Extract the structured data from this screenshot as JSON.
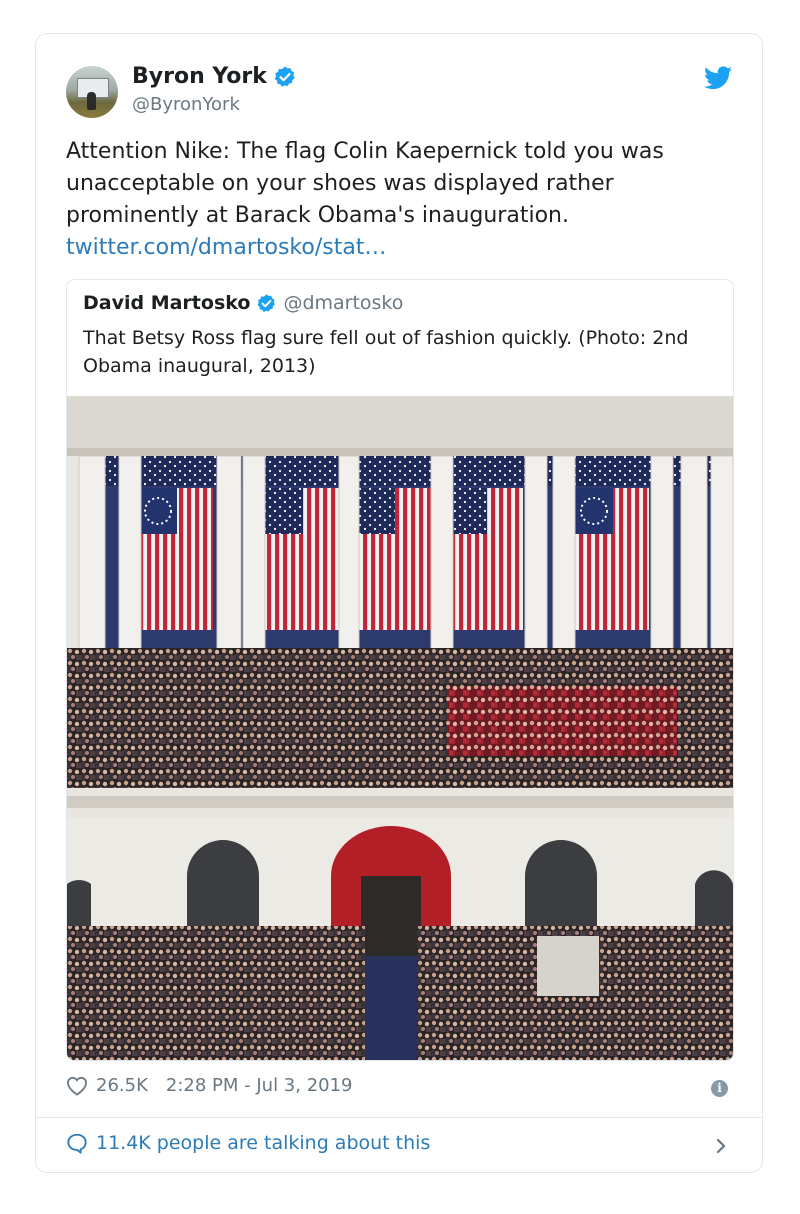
{
  "tweet": {
    "author_name": "Byron York",
    "author_handle": "@ByronYork",
    "text": "Attention Nike: The flag Colin Kaepernick told you was unacceptable on your shoes was displayed rather prominently at Barack Obama's inauguration.",
    "link_text": "twitter.com/dmartosko/stat…",
    "likes": "26.5K",
    "timestamp": "2:28 PM - Jul 3, 2019",
    "talking": "11.4K people are talking about this"
  },
  "quote": {
    "author_name": "David Martosko",
    "author_handle": "@dmartosko",
    "text": "That Betsy Ross flag sure fell out of fashion quickly. (Photo: 2nd Obama inaugural, 2013)"
  },
  "icons": {
    "verified": "verified-badge-icon",
    "bird": "twitter-bird-icon",
    "heart": "heart-icon",
    "info": "info-icon",
    "bubble": "chat-bubble-icon",
    "chevron": "chevron-right-icon"
  },
  "colors": {
    "link": "#2b7bb9",
    "verified": "#1da1f2",
    "muted": "#697882",
    "border": "#e1e8ed"
  }
}
